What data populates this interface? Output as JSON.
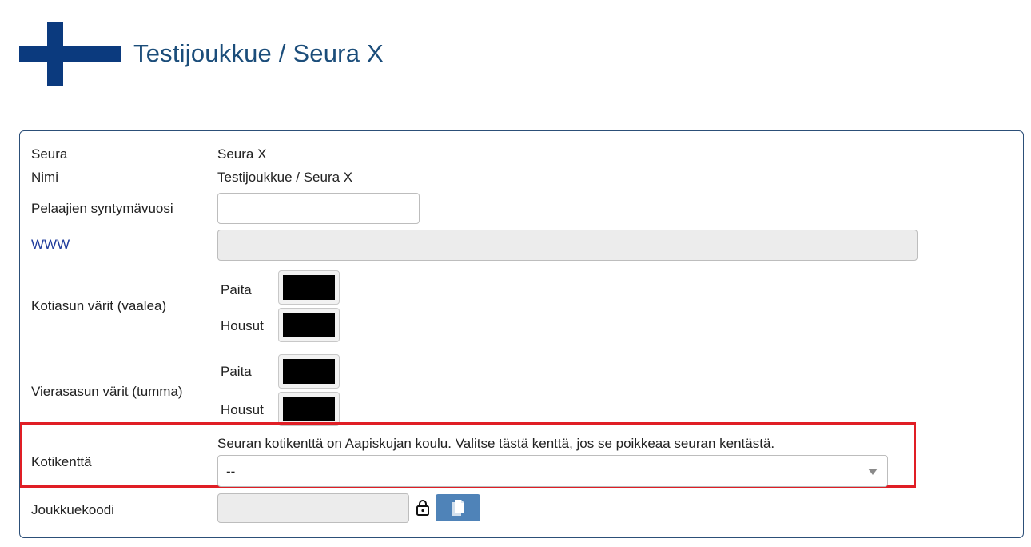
{
  "header": {
    "title": "Testijoukkue / Seura X",
    "flag_icon": "finland-flag-icon",
    "flag_colors": {
      "cross": "#0b3a7e",
      "field": "#ffffff"
    }
  },
  "team": {
    "club_label": "Seura",
    "club_value": "Seura X",
    "name_label": "Nimi",
    "name_value": "Testijoukkue / Seura X",
    "birth_year_label": "Pelaajien syntymävuosi",
    "birth_year_value": "",
    "www_label": "WWW",
    "www_value": ""
  },
  "home_colors": {
    "label": "Kotiasun värit (vaalea)",
    "shirt_label": "Paita",
    "shirt_color": "#000000",
    "shorts_label": "Housut",
    "shorts_color": "#000000"
  },
  "away_colors": {
    "label": "Vierasasun värit (tumma)",
    "shirt_label": "Paita",
    "shirt_color": "#000000",
    "shorts_label": "Housut",
    "shorts_color": "#000000"
  },
  "home_field": {
    "label": "Kotikenttä",
    "hint": "Seuran kotikenttä on Aapiskujan koulu. Valitse tästä kenttä, jos se poikkeaa seuran kentästä.",
    "selected": "--",
    "highlight_color": "#e01e25"
  },
  "team_code": {
    "label": "Joukkuekoodi",
    "value": "",
    "lock_icon": "lock-icon",
    "copy_icon": "copy-icon"
  },
  "colors": {
    "accent": "#1b4d7a",
    "panel_border": "#2c4f78",
    "button": "#4f83b8",
    "link": "#1f3b9c"
  }
}
